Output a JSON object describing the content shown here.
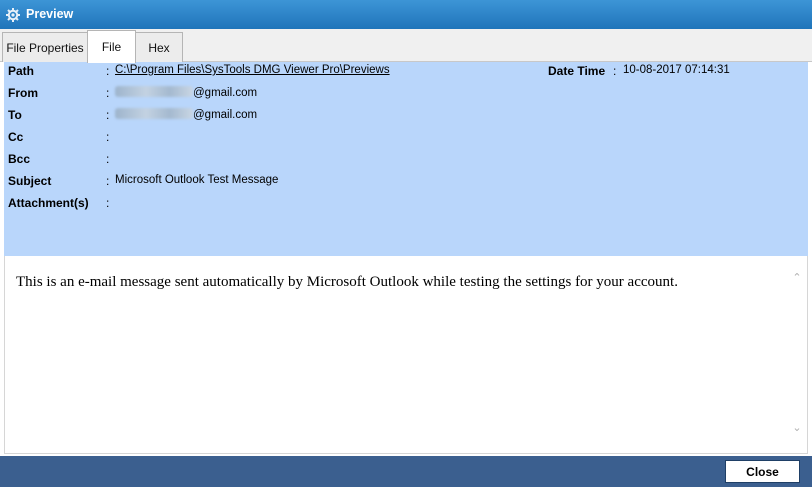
{
  "window": {
    "title": "Preview",
    "icon": "settings-gear-icon"
  },
  "tabs": [
    {
      "label": "File Properties",
      "active": false
    },
    {
      "label": "File",
      "active": true
    },
    {
      "label": "Hex",
      "active": false
    }
  ],
  "header": {
    "path": {
      "label": "Path",
      "value": "C:\\Program Files\\SysTools DMG Viewer Pro\\Previews"
    },
    "date_time": {
      "label": "Date Time",
      "value": "10-08-2017 07:14:31"
    },
    "from": {
      "label": "From",
      "value_suffix": "@gmail.com"
    },
    "to": {
      "label": "To",
      "value_suffix": "@gmail.com"
    },
    "cc": {
      "label": "Cc",
      "value": ""
    },
    "bcc": {
      "label": "Bcc",
      "value": ""
    },
    "subject": {
      "label": "Subject",
      "value": "Microsoft Outlook Test Message"
    },
    "attachments": {
      "label": "Attachment(s)",
      "value": ""
    },
    "separator": ":"
  },
  "body": {
    "text": "This is an e-mail message sent automatically by Microsoft Outlook while testing the settings for your account."
  },
  "footer": {
    "close_label": "Close"
  },
  "colors": {
    "titlebar": "#1f74ba",
    "header_panel": "#b9d6fb",
    "footer": "#3b5f8f"
  }
}
